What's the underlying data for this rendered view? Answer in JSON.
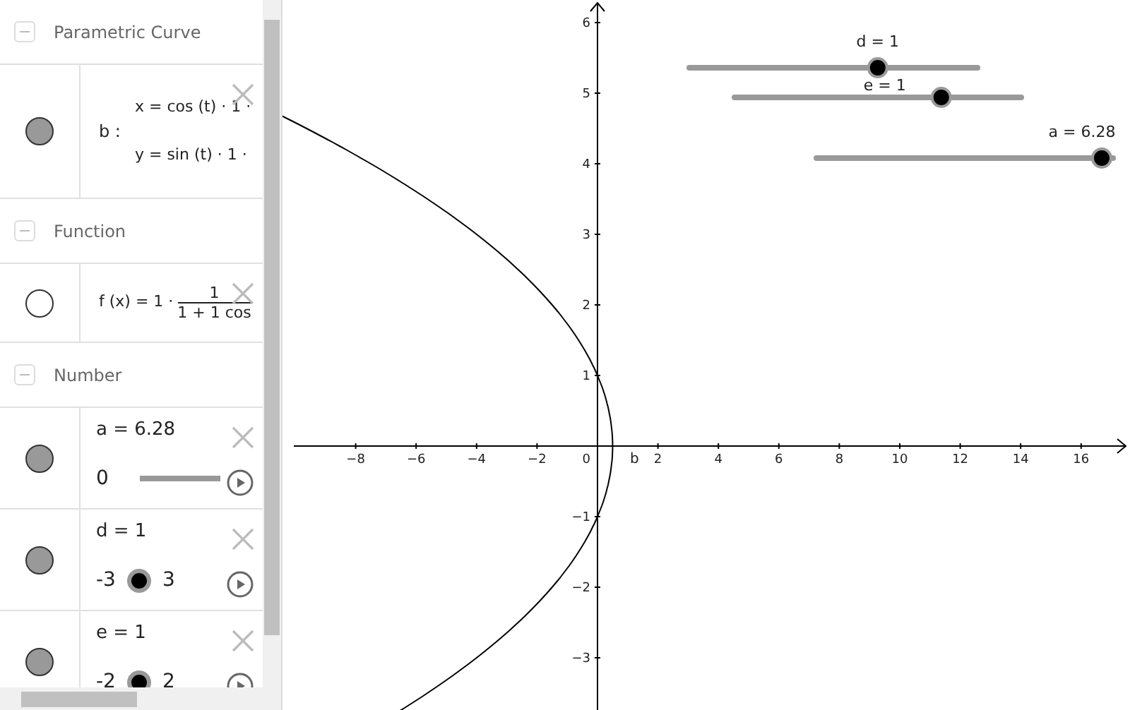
{
  "algebra": {
    "groups": [
      {
        "title": "Parametric Curve",
        "items": [
          {
            "kind": "curve",
            "visible": true,
            "name": "b :",
            "lines": [
              "x = cos (t) · 1 ·",
              "y = sin (t) · 1 ·"
            ]
          }
        ]
      },
      {
        "title": "Function",
        "items": [
          {
            "kind": "function",
            "visible": false,
            "lhs": "f (x) = 1 ·",
            "numerator": "1",
            "denominator": "1 + 1 cos"
          }
        ]
      },
      {
        "title": "Number",
        "items": [
          {
            "kind": "slider",
            "visible": true,
            "label": "a = 6.28",
            "min": "0"
          },
          {
            "kind": "slider",
            "visible": true,
            "label": "d = 1",
            "min": "-3",
            "max": "3"
          },
          {
            "kind": "slider",
            "visible": true,
            "label": "e = 1",
            "min": "-2",
            "max": "2"
          }
        ]
      }
    ]
  },
  "graph": {
    "origin": "0",
    "curve_label": "b",
    "x_ticks": [
      "−8",
      "−6",
      "−4",
      "−2",
      "2",
      "4",
      "6",
      "8",
      "10",
      "12",
      "14",
      "16"
    ],
    "y_ticks": [
      "6",
      "5",
      "4",
      "3",
      "2",
      "1",
      "−1",
      "−2",
      "−3"
    ],
    "sliders": [
      {
        "label": "d = 1",
        "level": 0.667
      },
      {
        "label": "e = 1",
        "level": 0.74
      },
      {
        "label": "a = 6.28",
        "level": 1
      }
    ]
  }
}
